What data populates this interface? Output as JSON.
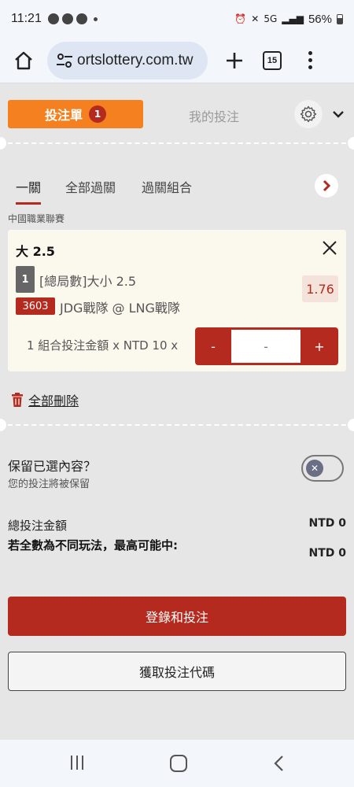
{
  "status_bar": {
    "time": "11:21",
    "battery": "56%",
    "network": "5G"
  },
  "browser": {
    "url": "ortslottery.com.tw",
    "tab_count": "15"
  },
  "header": {
    "tab_betslip": "投注單",
    "betslip_count": "1",
    "tab_my_bets": "我的投注"
  },
  "bet_types": {
    "single": "一關",
    "all_parlay": "全部過關",
    "parlay_combo": "過關組合"
  },
  "league": "中國職業聯賽",
  "bet": {
    "selection": "大 2.5",
    "index": "1",
    "market": "[總局數]大小 2.5",
    "odds": "1.76",
    "match_code": "3603",
    "match": "JDG戰隊 @ LNG戰隊",
    "stake_label": "1 組合投注金額 x NTD 10 x",
    "minus": "-",
    "amount": "-",
    "plus": "+"
  },
  "delete_all": "全部刪除",
  "keep": {
    "title": "保留已選內容？",
    "subtitle": "您的投注將被保留"
  },
  "summary": {
    "total_label": "總投注金額",
    "total_value": "NTD 0",
    "max_label": "若全數為不同玩法，最高可能中:",
    "max_value": "NTD 0"
  },
  "buttons": {
    "login_bet": "登錄和投注",
    "get_code": "獲取投注代碼"
  },
  "colors": {
    "accent_orange": "#f4801f",
    "brand_red": "#b52a1e",
    "card_bg": "#fbf8ee",
    "page_bg": "#e6e6e6"
  }
}
